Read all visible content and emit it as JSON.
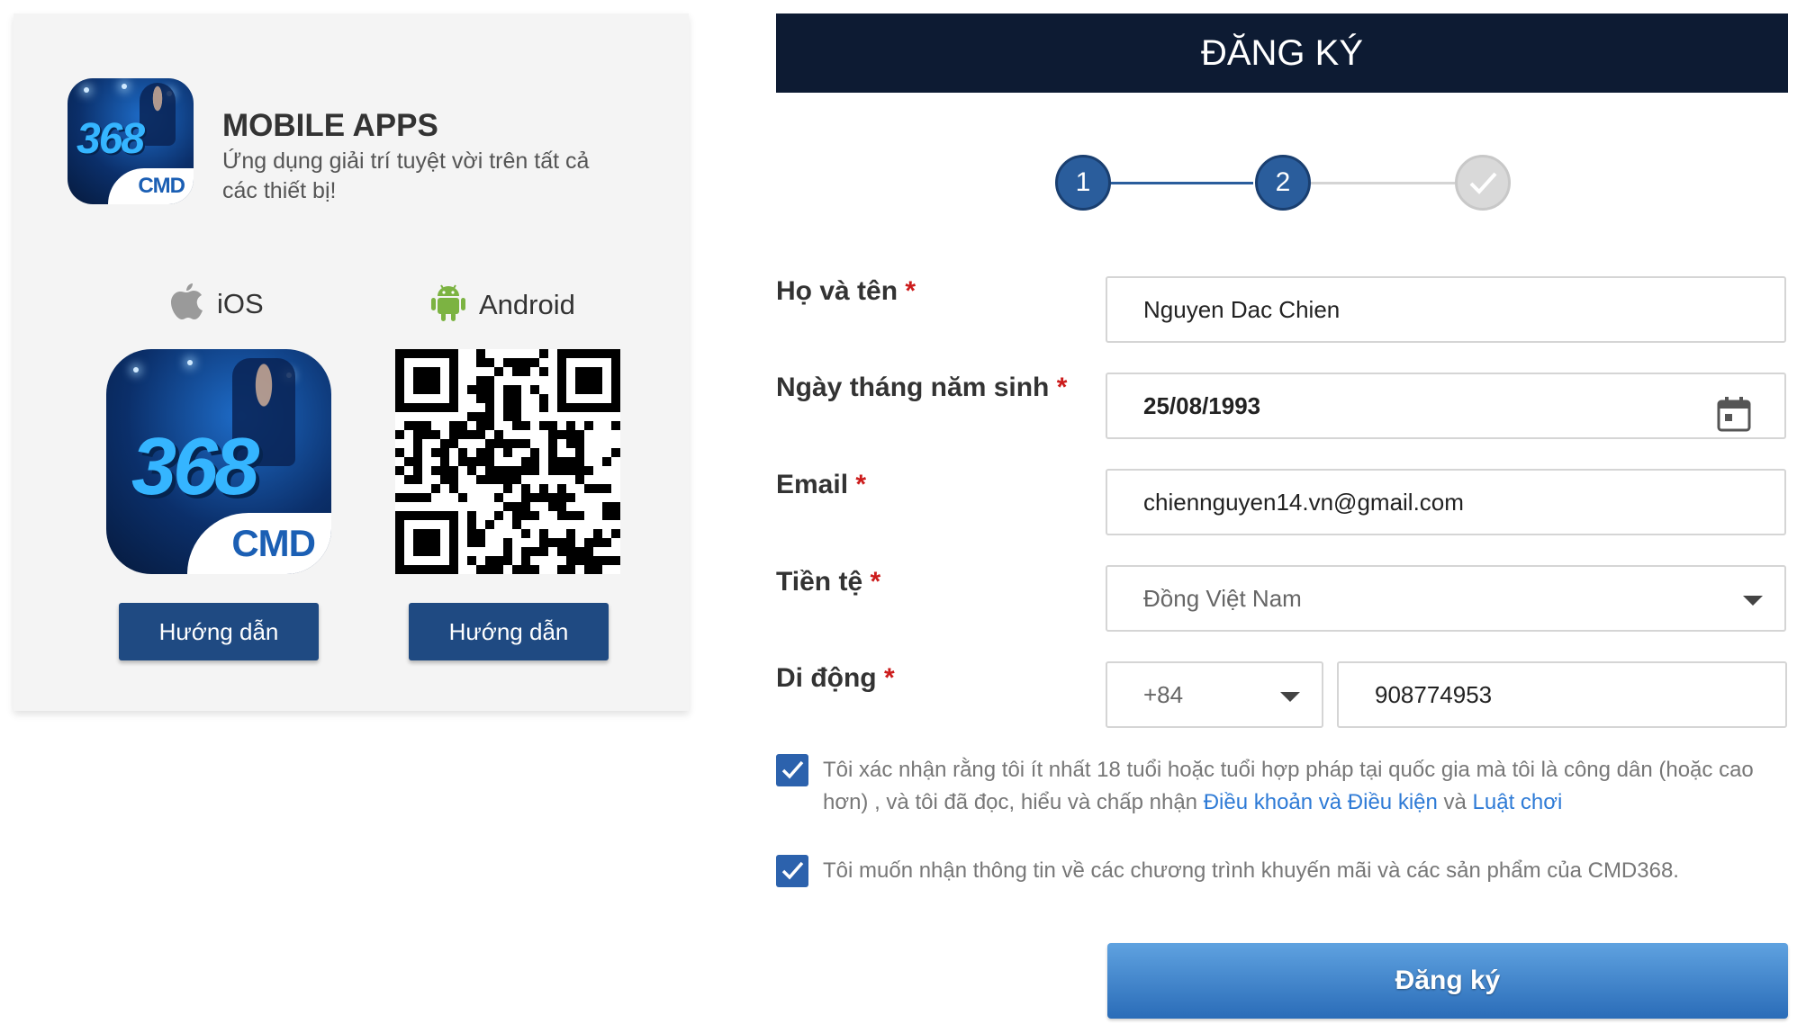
{
  "apps": {
    "title": "MOBILE APPS",
    "subtitle": "Ứng dụng giải trí tuyệt vời trên tất cả các thiết bị!",
    "logo_number": "368",
    "logo_brand": "CMD",
    "ios_label": "iOS",
    "android_label": "Android",
    "ios_guide_label": "Hướng dẫn",
    "android_guide_label": "Hướng dẫn"
  },
  "register": {
    "header": "ĐĂNG KÝ",
    "steps": [
      "1",
      "2"
    ],
    "fullname": {
      "label": "Họ và tên",
      "value": "Nguyen Dac Chien"
    },
    "birthdate": {
      "label": "Ngày tháng năm sinh",
      "value": "25/08/1993"
    },
    "email": {
      "label": "Email",
      "value": "chiennguyen14.vn@gmail.com"
    },
    "currency": {
      "label": "Tiền tệ",
      "value": "Đồng Việt Nam"
    },
    "mobile": {
      "label": "Di động",
      "country_code": "+84",
      "value": "908774953"
    },
    "required_mark": "*",
    "consent_age_text": "Tôi xác nhận rằng tôi ít nhất 18 tuổi hoặc tuổi hợp pháp tại quốc gia mà tôi là công dân (hoặc cao hơn) , và tôi đã đọc, hiểu và chấp nhận",
    "terms_link": "Điều khoản và Điều kiện",
    "and_word": "và",
    "rules_link": "Luật chơi",
    "consent_promo_text": "Tôi muốn nhận thông tin về các chương trình khuyến mãi và các sản phẩm của CMD368.",
    "submit_label": "Đăng ký"
  },
  "colors": {
    "header_bg": "#0d1b33",
    "step_active": "#2a5d9c",
    "button_blue": "#1f4a82",
    "checkbox": "#2c62ad",
    "required": "#cc1b1b",
    "link": "#2d7ad6"
  },
  "icons": [
    "apple-icon",
    "android-icon",
    "calendar-icon",
    "chevron-down-icon",
    "check-icon",
    "qr-code"
  ]
}
